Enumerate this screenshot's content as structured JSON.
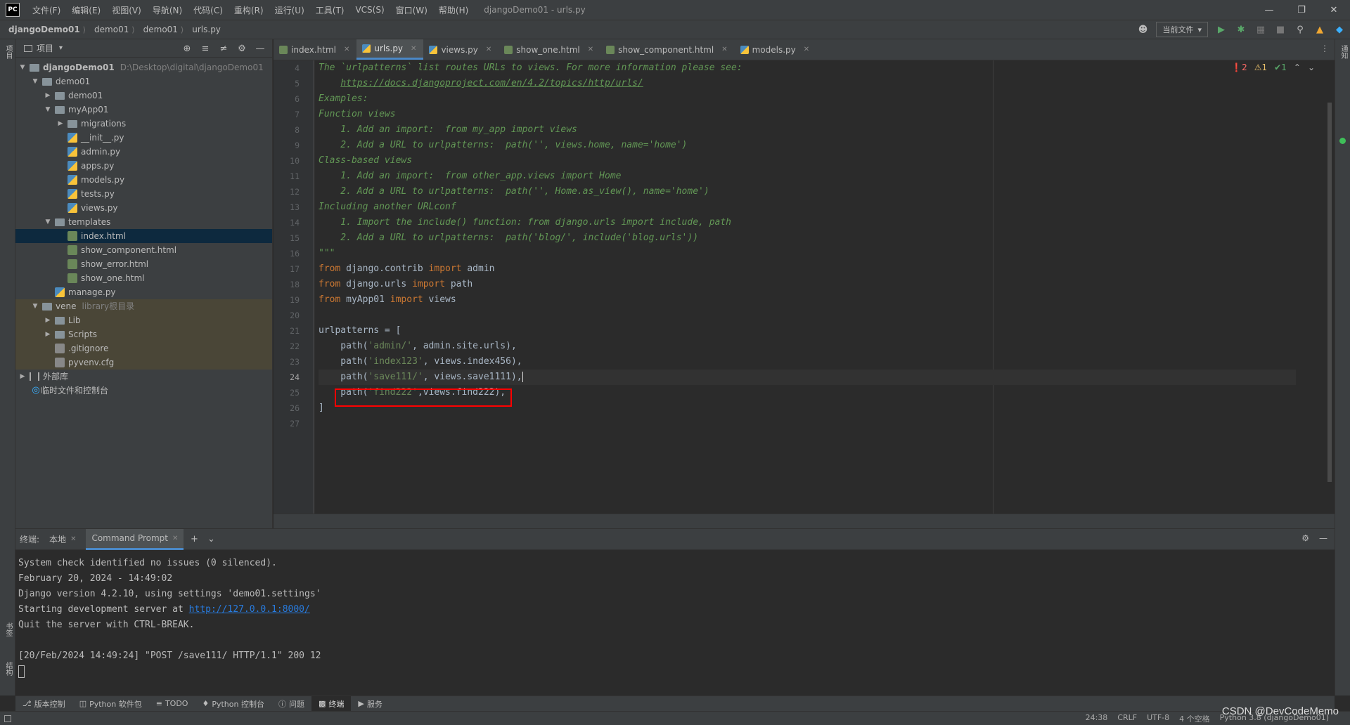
{
  "titlebar": {
    "logo": "PC",
    "menus": [
      "文件(F)",
      "编辑(E)",
      "视图(V)",
      "导航(N)",
      "代码(C)",
      "重构(R)",
      "运行(U)",
      "工具(T)",
      "VCS(S)",
      "窗口(W)",
      "帮助(H)"
    ],
    "window_title": "djangoDemo01 - urls.py"
  },
  "navbar": {
    "crumbs": [
      "djangoDemo01",
      "demo01",
      "demo01",
      "urls.py"
    ],
    "run_config": "当前文件"
  },
  "leftstrip": {
    "project_label": "项目",
    "bookmarks_label": "书签",
    "structure_label": "结构"
  },
  "rightstrip": {
    "notifications_label": "通知"
  },
  "project": {
    "title": "项目",
    "tree": [
      {
        "label": "djangoDemo01",
        "extra": "D:\\Desktop\\digital\\djangoDemo01"
      },
      {
        "label": "demo01"
      },
      {
        "label": "demo01"
      },
      {
        "label": "myApp01"
      },
      {
        "label": "migrations"
      },
      {
        "label": "__init__.py"
      },
      {
        "label": "admin.py"
      },
      {
        "label": "apps.py"
      },
      {
        "label": "models.py"
      },
      {
        "label": "tests.py"
      },
      {
        "label": "views.py"
      },
      {
        "label": "templates"
      },
      {
        "label": "index.html"
      },
      {
        "label": "show_component.html"
      },
      {
        "label": "show_error.html"
      },
      {
        "label": "show_one.html"
      },
      {
        "label": "manage.py"
      },
      {
        "label": "vene",
        "extra": "library根目录"
      },
      {
        "label": "Lib"
      },
      {
        "label": "Scripts"
      },
      {
        "label": ".gitignore"
      },
      {
        "label": "pyvenv.cfg"
      },
      {
        "label": "外部库"
      },
      {
        "label": "临时文件和控制台"
      }
    ]
  },
  "tabs": [
    {
      "label": "index.html"
    },
    {
      "label": "urls.py"
    },
    {
      "label": "views.py"
    },
    {
      "label": "show_one.html"
    },
    {
      "label": "show_component.html"
    },
    {
      "label": "models.py"
    }
  ],
  "inspections": {
    "errors": "2",
    "warnings": "1",
    "ok": "1"
  },
  "code": {
    "line_numbers": [
      "4",
      "5",
      "6",
      "7",
      "8",
      "9",
      "10",
      "11",
      "12",
      "13",
      "14",
      "15",
      "16",
      "17",
      "18",
      "19",
      "20",
      "21",
      "22",
      "23",
      "24",
      "25",
      "26",
      "27"
    ],
    "l4": "The `urlpatterns` list routes URLs to views. For more information please see:",
    "l5": "https://docs.djangoproject.com/en/4.2/topics/http/urls/",
    "l6": "Examples:",
    "l7": "Function views",
    "l8": "    1. Add an import:  from my_app import views",
    "l9": "    2. Add a URL to urlpatterns:  path('', views.home, name='home')",
    "l10": "Class-based views",
    "l11": "    1. Add an import:  from other_app.views import Home",
    "l12": "    2. Add a URL to urlpatterns:  path('', Home.as_view(), name='home')",
    "l13": "Including another URLconf",
    "l14": "    1. Import the include() function: from django.urls import include, path",
    "l15": "    2. Add a URL to urlpatterns:  path('blog/', include('blog.urls'))",
    "l16": "\"\"\"",
    "kw_from": "from",
    "kw_import": "import",
    "l17_mod": " django.contrib ",
    "l17_name": " admin",
    "l18_mod": " django.urls ",
    "l18_name": " path",
    "l19_mod": " myApp01 ",
    "l19_name": " views",
    "l21": "urlpatterns = [",
    "path_open": "    path(",
    "l22_str": "'admin/'",
    "l22_rest": ", admin.site.urls),",
    "l23_str": "'index123'",
    "l23_rest": ", views.index456),",
    "l24_str": "'save111/'",
    "l24_rest": ", views.save1111),",
    "l25_str": "'find222'",
    "l25_rest": ",views.find222),",
    "l26": "]"
  },
  "terminal": {
    "label": "终端:",
    "tabs": [
      "本地",
      "Command Prompt"
    ],
    "lines": [
      "System check identified no issues (0 silenced).",
      "February 20, 2024 - 14:49:02",
      "Django version 4.2.10, using settings 'demo01.settings'",
      "Starting development server at ",
      "Quit the server with CTRL-BREAK.",
      "",
      "[20/Feb/2024 14:49:24] \"POST /save111/ HTTP/1.1\" 200 12"
    ],
    "server_url": "http://127.0.0.1:8000/"
  },
  "toolwindows": [
    "版本控制",
    "Python 软件包",
    "TODO",
    "Python 控制台",
    "问题",
    "终端",
    "服务"
  ],
  "status": {
    "position": "24:38",
    "line_sep": "CRLF",
    "encoding": "UTF-8",
    "indent": "4 个空格",
    "interpreter": "Python 3.8 (djangoDemo01)"
  },
  "watermark": "CSDN @DevCodeMemo",
  "colors": {
    "accent": "#4a88c7",
    "highlight_box": "#ff0000",
    "selection": "#0d293e",
    "excluded": "#4a4637"
  }
}
